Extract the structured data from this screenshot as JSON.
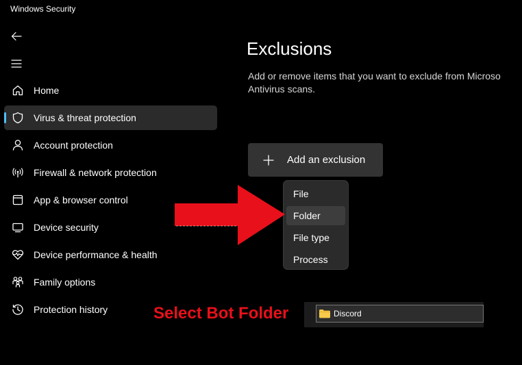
{
  "window": {
    "title": "Windows Security"
  },
  "icons": {
    "back": "back-arrow-icon",
    "menu": "hamburger-menu-icon",
    "add": "plus-icon",
    "folder": "folder-icon"
  },
  "sidebar": {
    "items": [
      {
        "label": "Home",
        "icon": "home-icon",
        "selected": false
      },
      {
        "label": "Virus & threat protection",
        "icon": "shield-icon",
        "selected": true
      },
      {
        "label": "Account protection",
        "icon": "person-icon",
        "selected": false
      },
      {
        "label": "Firewall & network protection",
        "icon": "wifi-antenna-icon",
        "selected": false
      },
      {
        "label": "App & browser control",
        "icon": "browser-window-icon",
        "selected": false
      },
      {
        "label": "Device security",
        "icon": "laptop-icon",
        "selected": false
      },
      {
        "label": "Device performance & health",
        "icon": "heart-pulse-icon",
        "selected": false
      },
      {
        "label": "Family options",
        "icon": "family-icon",
        "selected": false
      },
      {
        "label": "Protection history",
        "icon": "history-clock-icon",
        "selected": false
      }
    ]
  },
  "main": {
    "title": "Exclusions",
    "description_line1": "Add or remove items that you want to exclude from Microso",
    "description_line2": "Antivirus scans.",
    "add_button_label": "Add an exclusion",
    "dropdown": {
      "options": [
        "File",
        "Folder",
        "File type",
        "Process"
      ],
      "highlighted": "Folder"
    }
  },
  "annotation": {
    "text": "Select Bot Folder",
    "color": "#e8101a",
    "folder_name": "Discord"
  },
  "colors": {
    "background": "#000000",
    "accent": "#4cc2ff",
    "selected_nav": "#2b2b2b",
    "button": "#333333",
    "arrow": "#e8101a",
    "folder": "#f8c94a"
  }
}
